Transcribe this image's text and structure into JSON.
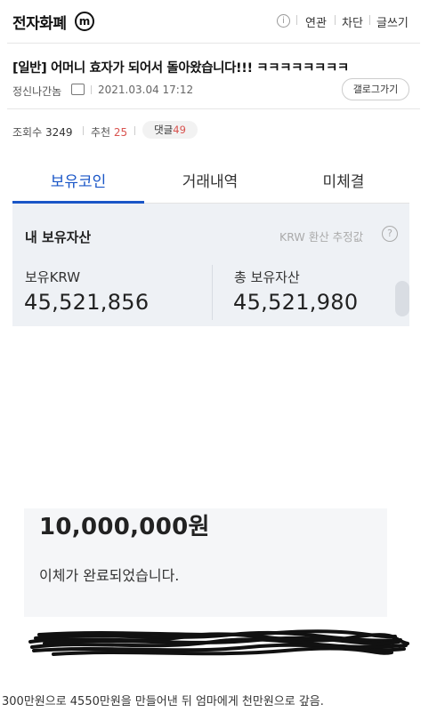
{
  "header": {
    "gallery_name": "전자화폐",
    "badge": "m",
    "info_icon": "i",
    "links": [
      "연관",
      "차단",
      "글쓰기"
    ]
  },
  "post": {
    "title": "[일반] 어머니 효자가 되어서 돌아왔습니다!!! ㅋㅋㅋㅋㅋㅋㅋㅋ",
    "author": "정신나간놈",
    "date": "2021.03.04 17:12",
    "gallery_button": "갤로그가기",
    "views_label": "조회수",
    "views": "3249",
    "recommend_label": "추천",
    "recommend": "25",
    "comments_label": "댓글",
    "comments": "49"
  },
  "wallet": {
    "tabs": [
      "보유코인",
      "거래내역",
      "미체결"
    ],
    "active_tab": 0,
    "heading": "내 보유자산",
    "note": "KRW 환산 추정값",
    "help_icon": "?",
    "krw_label": "보유KRW",
    "krw_value": "45,521,856",
    "total_label": "총 보유자산",
    "total_value": "45,521,980"
  },
  "transfer": {
    "amount": "10,000,000원",
    "message": "이체가 완료되었습니다."
  },
  "caption": "300만원으로 4550만원을 만들어낸 뒤 엄마에게 천만원으로 갚음.",
  "colors": {
    "accent": "#1a56c7",
    "highlight_red": "#d9534f",
    "panel_bg": "#eef1f5"
  },
  "icons": {
    "author_badge": "gallog-icon",
    "info": "info-icon",
    "help": "question-icon",
    "scroll": "scroll-handle"
  }
}
